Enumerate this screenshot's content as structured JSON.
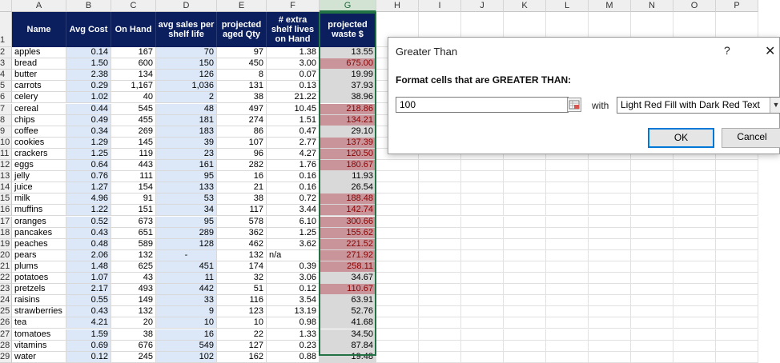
{
  "columns": [
    "A",
    "B",
    "C",
    "D",
    "E",
    "F",
    "G",
    "H",
    "I",
    "J",
    "K",
    "L",
    "M",
    "N",
    "O",
    "P"
  ],
  "row_numbers": [
    "1",
    "2",
    "3",
    "4",
    "5",
    "6",
    "7",
    "8",
    "9",
    "10",
    "11",
    "12",
    "13",
    "14",
    "15",
    "16",
    "17",
    "18",
    "19",
    "20",
    "21",
    "22",
    "23",
    "24",
    "25",
    "26",
    "27",
    "28",
    "29"
  ],
  "headers": [
    "Name",
    "Avg Cost",
    "On Hand",
    "avg sales per shelf life",
    "projected aged Qty",
    "# extra shelf lives on Hand",
    "projected waste $"
  ],
  "rows": [
    [
      "apples",
      "0.14",
      "167",
      "70",
      "97",
      "1.38",
      "13.55"
    ],
    [
      "bread",
      "1.50",
      "600",
      "150",
      "450",
      "3.00",
      "675.00"
    ],
    [
      "butter",
      "2.38",
      "134",
      "126",
      "8",
      "0.07",
      "19.99"
    ],
    [
      "carrots",
      "0.29",
      "1,167",
      "1,036",
      "131",
      "0.13",
      "37.93"
    ],
    [
      "celery",
      "1.02",
      "40",
      "2",
      "38",
      "21.22",
      "38.96"
    ],
    [
      "cereal",
      "0.44",
      "545",
      "48",
      "497",
      "10.45",
      "218.86"
    ],
    [
      "chips",
      "0.49",
      "455",
      "181",
      "274",
      "1.51",
      "134.21"
    ],
    [
      "coffee",
      "0.34",
      "269",
      "183",
      "86",
      "0.47",
      "29.10"
    ],
    [
      "cookies",
      "1.29",
      "145",
      "39",
      "107",
      "2.77",
      "137.39"
    ],
    [
      "crackers",
      "1.25",
      "119",
      "23",
      "96",
      "4.27",
      "120.50"
    ],
    [
      "eggs",
      "0.64",
      "443",
      "161",
      "282",
      "1.76",
      "180.67"
    ],
    [
      "jelly",
      "0.76",
      "111",
      "95",
      "16",
      "0.16",
      "11.93"
    ],
    [
      "juice",
      "1.27",
      "154",
      "133",
      "21",
      "0.16",
      "26.54"
    ],
    [
      "milk",
      "4.96",
      "91",
      "53",
      "38",
      "0.72",
      "188.48"
    ],
    [
      "muffins",
      "1.22",
      "151",
      "34",
      "117",
      "3.44",
      "142.74"
    ],
    [
      "oranges",
      "0.52",
      "673",
      "95",
      "578",
      "6.10",
      "300.66"
    ],
    [
      "pancakes",
      "0.43",
      "651",
      "289",
      "362",
      "1.25",
      "155.62"
    ],
    [
      "peaches",
      "0.48",
      "589",
      "128",
      "462",
      "3.62",
      "221.52"
    ],
    [
      "pears",
      "2.06",
      "132",
      "-",
      "132",
      "n/a",
      "271.92"
    ],
    [
      "plums",
      "1.48",
      "625",
      "451",
      "174",
      "0.39",
      "258.11"
    ],
    [
      "potatoes",
      "1.07",
      "43",
      "11",
      "32",
      "3.06",
      "34.67"
    ],
    [
      "pretzels",
      "2.17",
      "493",
      "442",
      "51",
      "0.12",
      "110.67"
    ],
    [
      "raisins",
      "0.55",
      "149",
      "33",
      "116",
      "3.54",
      "63.91"
    ],
    [
      "strawberries",
      "0.43",
      "132",
      "9",
      "123",
      "13.19",
      "52.76"
    ],
    [
      "tea",
      "4.21",
      "20",
      "10",
      "10",
      "0.98",
      "41.68"
    ],
    [
      "tomatoes",
      "1.59",
      "38",
      "16",
      "22",
      "1.33",
      "34.50"
    ],
    [
      "vitamins",
      "0.69",
      "676",
      "549",
      "127",
      "0.23",
      "87.84"
    ],
    [
      "water",
      "0.12",
      "245",
      "102",
      "162",
      "0.88",
      "19.48"
    ]
  ],
  "highlighted_rows": [
    1,
    5,
    6,
    8,
    9,
    10,
    13,
    14,
    15,
    16,
    17,
    18,
    19,
    21
  ],
  "dialog": {
    "title": "Greater Than",
    "help": "?",
    "close": "✕",
    "label": "Format cells that are GREATER THAN:",
    "value": "100",
    "with_label": "with",
    "format_option": "Light Red Fill with Dark Red Text",
    "ok": "OK",
    "cancel": "Cancel"
  },
  "colors": {
    "header_bg": "#0b1f5e",
    "blue_fill": "#dce8f7",
    "red_fill": "#c9959a",
    "red_text": "#8b0000"
  }
}
